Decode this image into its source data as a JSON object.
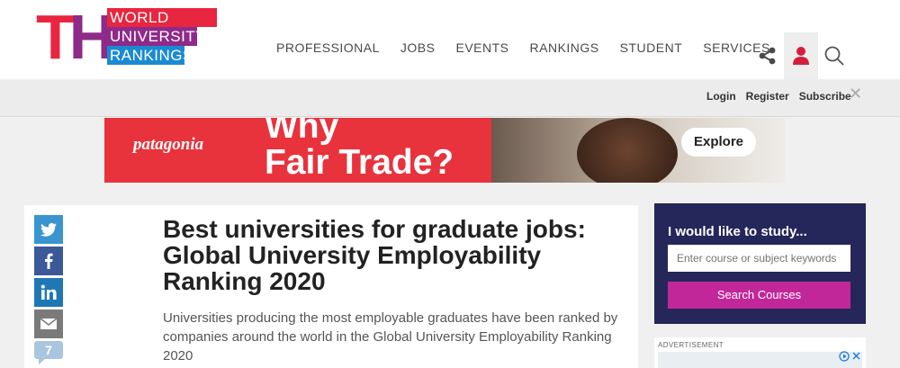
{
  "logo": {
    "letters": [
      "T",
      "H",
      "E"
    ],
    "words": [
      "WORLD",
      "UNIVERSITY",
      "RANKINGS"
    ],
    "colors": [
      "#e8263f",
      "#8e2a89",
      "#1b8ad3"
    ]
  },
  "nav": {
    "items": [
      "PROFESSIONAL",
      "JOBS",
      "EVENTS",
      "RANKINGS",
      "STUDENT",
      "SERVICES"
    ]
  },
  "header_icons": [
    "share-icon",
    "user-icon",
    "search-icon"
  ],
  "subbar": {
    "links": [
      "Login",
      "Register",
      "Subscribe"
    ],
    "close": "✕"
  },
  "banner": {
    "brand": "patagonia",
    "headline_line1": "Why",
    "headline_line2": "Fair Trade?",
    "cta": "Explore",
    "bg_color": "#e8323c"
  },
  "share": {
    "comment_count": "7"
  },
  "article": {
    "title": "Best universities for graduate jobs: Global University Employability Ranking 2020",
    "standfirst": "Universities producing the most employable graduates have been ranked by companies around the world in the Global University Employability Ranking 2020"
  },
  "study_widget": {
    "title": "I would like to study...",
    "input_placeholder": "Enter course or subject keywords",
    "button_label": "Search Courses",
    "bg_color": "#252659",
    "button_color": "#c2279a"
  },
  "advertisement": {
    "label": "ADVERTISEMENT"
  }
}
